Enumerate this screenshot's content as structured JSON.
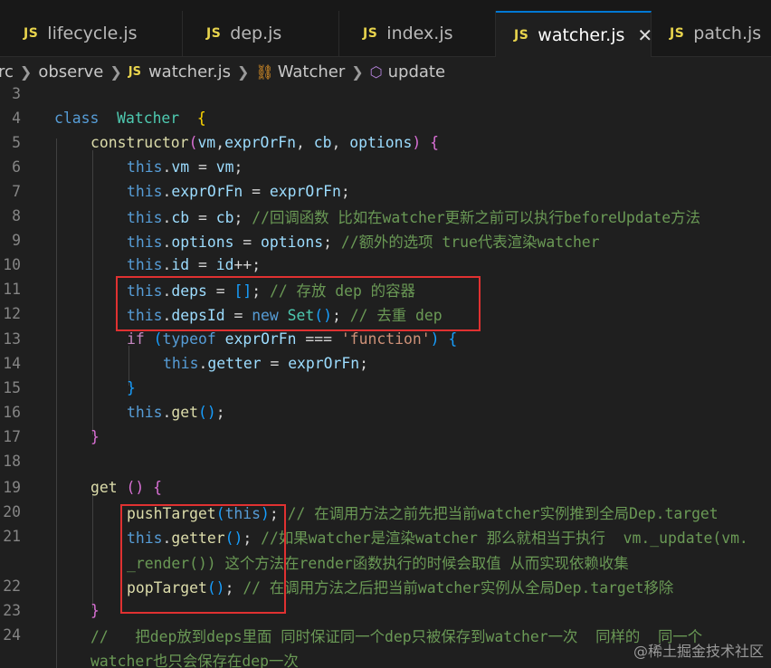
{
  "tabs": [
    {
      "icon": "JS",
      "label": "lifecycle.js"
    },
    {
      "icon": "JS",
      "label": "dep.js"
    },
    {
      "icon": "JS",
      "label": "index.js"
    },
    {
      "icon": "JS",
      "label": "watcher.js",
      "active": true
    },
    {
      "icon": "JS",
      "label": "patch.js"
    }
  ],
  "breadcrumb": {
    "src": "rc",
    "folder": "observe",
    "file_icon": "JS",
    "file": "watcher.js",
    "class": "Watcher",
    "method": "update"
  },
  "lines": [
    {
      "n": "3",
      "tokens": []
    },
    {
      "n": "4",
      "tokens": [
        [
          "kw",
          "class"
        ],
        [
          "",
          "  "
        ],
        [
          "cls",
          "Watcher"
        ],
        [
          "",
          "  "
        ],
        [
          "brY",
          "{"
        ]
      ]
    },
    {
      "n": "5",
      "tokens": [
        [
          "fn",
          "constructor"
        ],
        [
          "brP",
          "("
        ],
        [
          "var",
          "vm"
        ],
        [
          "",
          ","
        ],
        [
          "var",
          "exprOrFn"
        ],
        [
          "",
          ", "
        ],
        [
          "var",
          "cb"
        ],
        [
          "",
          ", "
        ],
        [
          "var",
          "options"
        ],
        [
          "brP",
          ")"
        ],
        [
          "",
          " "
        ],
        [
          "brP",
          "{"
        ]
      ]
    },
    {
      "n": "6",
      "tokens": [
        [
          "kw",
          "this"
        ],
        [
          "",
          "."
        ],
        [
          "var",
          "vm"
        ],
        [
          "",
          " = "
        ],
        [
          "var",
          "vm"
        ],
        [
          "",
          ";"
        ]
      ]
    },
    {
      "n": "7",
      "tokens": [
        [
          "kw",
          "this"
        ],
        [
          "",
          "."
        ],
        [
          "var",
          "exprOrFn"
        ],
        [
          "",
          " = "
        ],
        [
          "var",
          "exprOrFn"
        ],
        [
          "",
          ";"
        ]
      ]
    },
    {
      "n": "8",
      "tokens": [
        [
          "kw",
          "this"
        ],
        [
          "",
          "."
        ],
        [
          "var",
          "cb"
        ],
        [
          "",
          " = "
        ],
        [
          "var",
          "cb"
        ],
        [
          "",
          "; "
        ],
        [
          "cmt",
          "//回调函数 比如在watcher更新之前可以执行beforeUpdate方法"
        ]
      ]
    },
    {
      "n": "9",
      "tokens": [
        [
          "kw",
          "this"
        ],
        [
          "",
          "."
        ],
        [
          "var",
          "options"
        ],
        [
          "",
          " = "
        ],
        [
          "var",
          "options"
        ],
        [
          "",
          "; "
        ],
        [
          "cmt",
          "//额外的选项 true代表渲染watcher"
        ]
      ]
    },
    {
      "n": "10",
      "tokens": [
        [
          "kw",
          "this"
        ],
        [
          "",
          "."
        ],
        [
          "var",
          "id"
        ],
        [
          "",
          " = "
        ],
        [
          "var",
          "id"
        ],
        [
          "",
          "++;"
        ]
      ]
    },
    {
      "n": "11",
      "tokens": [
        [
          "kw",
          "this"
        ],
        [
          "",
          "."
        ],
        [
          "var",
          "deps"
        ],
        [
          "",
          " = "
        ],
        [
          "brB",
          "[]"
        ],
        [
          "",
          "; "
        ],
        [
          "cmt",
          "// 存放 dep 的容器"
        ]
      ]
    },
    {
      "n": "12",
      "tokens": [
        [
          "kw",
          "this"
        ],
        [
          "",
          "."
        ],
        [
          "var",
          "depsId"
        ],
        [
          "",
          " = "
        ],
        [
          "kw",
          "new"
        ],
        [
          "",
          " "
        ],
        [
          "cls",
          "Set"
        ],
        [
          "brB",
          "()"
        ],
        [
          "",
          "; "
        ],
        [
          "cmt",
          "// 去重 dep"
        ]
      ]
    },
    {
      "n": "13",
      "tokens": [
        [
          "ctl",
          "if"
        ],
        [
          "",
          " "
        ],
        [
          "brB",
          "("
        ],
        [
          "kw",
          "typeof"
        ],
        [
          "",
          " "
        ],
        [
          "var",
          "exprOrFn"
        ],
        [
          "",
          " === "
        ],
        [
          "str",
          "'function'"
        ],
        [
          "brB",
          ")"
        ],
        [
          "",
          " "
        ],
        [
          "brB",
          "{"
        ]
      ]
    },
    {
      "n": "14",
      "tokens": [
        [
          "kw",
          "this"
        ],
        [
          "",
          "."
        ],
        [
          "var",
          "getter"
        ],
        [
          "",
          " = "
        ],
        [
          "var",
          "exprOrFn"
        ],
        [
          "",
          ";"
        ]
      ]
    },
    {
      "n": "15",
      "tokens": [
        [
          "brB",
          "}"
        ]
      ]
    },
    {
      "n": "16",
      "tokens": [
        [
          "kw",
          "this"
        ],
        [
          "",
          "."
        ],
        [
          "fn",
          "get"
        ],
        [
          "brB",
          "()"
        ],
        [
          "",
          ";"
        ]
      ]
    },
    {
      "n": "17",
      "tokens": [
        [
          "brP",
          "}"
        ]
      ]
    },
    {
      "n": "18",
      "tokens": []
    },
    {
      "n": "19",
      "tokens": [
        [
          "fn",
          "get"
        ],
        [
          "",
          " "
        ],
        [
          "brP",
          "()"
        ],
        [
          "",
          " "
        ],
        [
          "brP",
          "{"
        ]
      ]
    },
    {
      "n": "20",
      "tokens": [
        [
          "fn",
          "pushTarget"
        ],
        [
          "brB",
          "("
        ],
        [
          "kw",
          "this"
        ],
        [
          "brB",
          ")"
        ],
        [
          "",
          "; "
        ],
        [
          "cmt",
          "// 在调用方法之前先把当前watcher实例推到全局Dep.target"
        ]
      ]
    },
    {
      "n": "21",
      "tokens": [
        [
          "kw",
          "this"
        ],
        [
          "",
          "."
        ],
        [
          "fn",
          "getter"
        ],
        [
          "brB",
          "()"
        ],
        [
          "",
          "; "
        ],
        [
          "cmt",
          "//如果watcher是渲染watcher 那么就相当于执行  vm._update(vm."
        ]
      ]
    },
    {
      "n": "",
      "tokens": [
        [
          "cmt",
          "_render()) 这个方法在render函数执行的时候会取值 从而实现依赖收集"
        ]
      ]
    },
    {
      "n": "22",
      "tokens": [
        [
          "fn",
          "popTarget"
        ],
        [
          "brB",
          "()"
        ],
        [
          "",
          "; "
        ],
        [
          "cmt",
          "// 在调用方法之后把当前watcher实例从全局Dep.target移除"
        ]
      ]
    },
    {
      "n": "23",
      "tokens": [
        [
          "brP",
          "}"
        ]
      ]
    },
    {
      "n": "24",
      "tokens": [
        [
          "cmt",
          "//   把dep放到deps里面 同时保证同一个dep只被保存到watcher一次  同样的  同一个"
        ]
      ]
    },
    {
      "n": "",
      "tokens": [
        [
          "cmt",
          "watcher也只会保存在dep一次"
        ]
      ]
    }
  ],
  "watermark": "@稀土掘金技术社区"
}
